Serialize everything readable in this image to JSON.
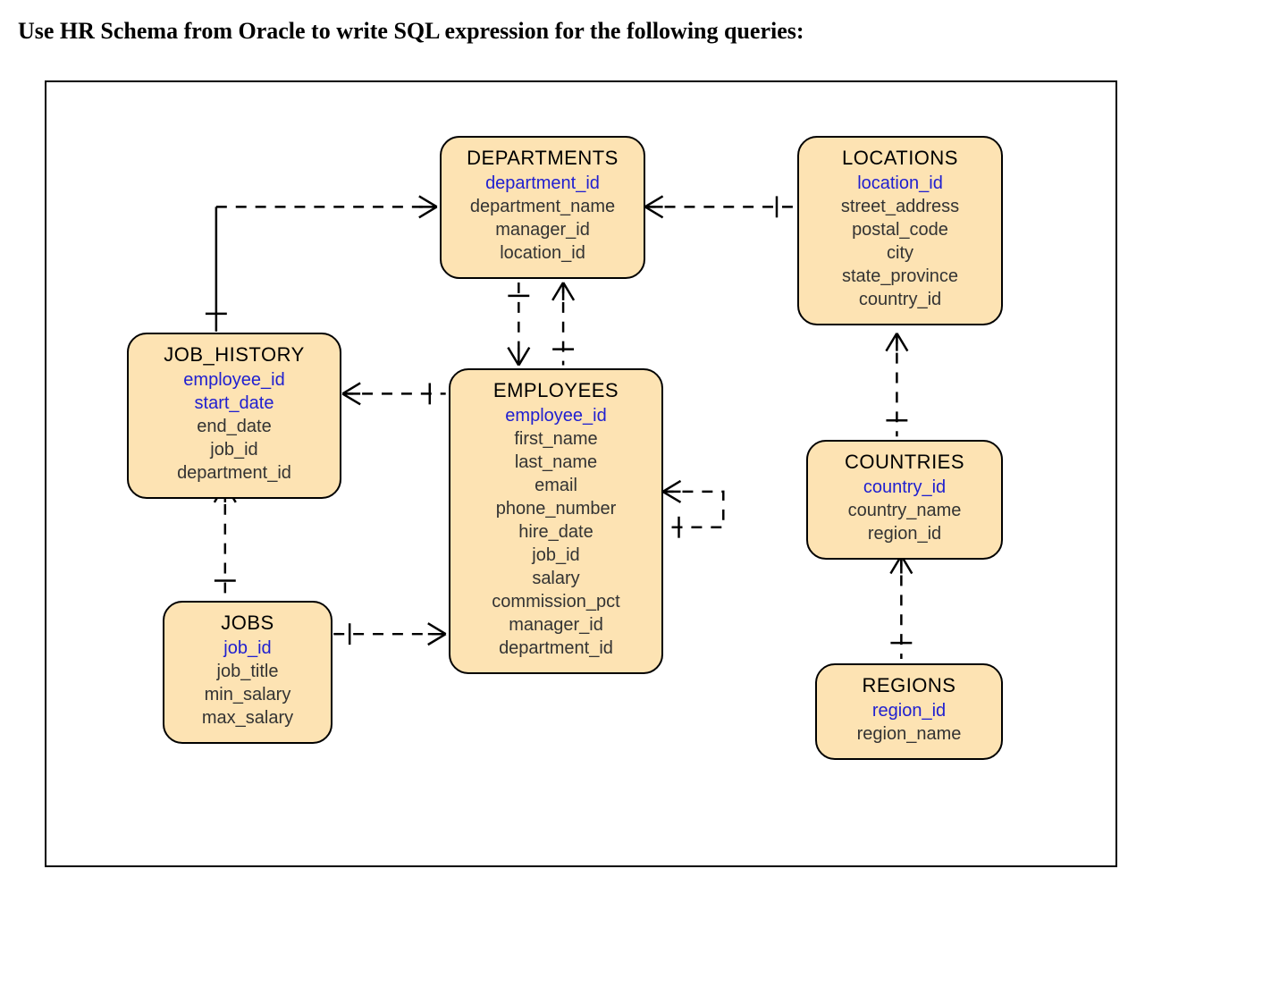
{
  "heading": "Use HR Schema from Oracle to write SQL expression for the following queries:",
  "entities": {
    "departments": {
      "title": "DEPARTMENTS",
      "fields": [
        {
          "name": "department_id",
          "pk": true
        },
        {
          "name": "department_name",
          "pk": false
        },
        {
          "name": "manager_id",
          "pk": false
        },
        {
          "name": "location_id",
          "pk": false
        }
      ]
    },
    "locations": {
      "title": "LOCATIONS",
      "fields": [
        {
          "name": "location_id",
          "pk": true
        },
        {
          "name": "street_address",
          "pk": false
        },
        {
          "name": "postal_code",
          "pk": false
        },
        {
          "name": "city",
          "pk": false
        },
        {
          "name": "state_province",
          "pk": false
        },
        {
          "name": "country_id",
          "pk": false
        }
      ]
    },
    "job_history": {
      "title": "JOB_HISTORY",
      "fields": [
        {
          "name": "employee_id",
          "pk": true
        },
        {
          "name": "start_date",
          "pk": true
        },
        {
          "name": "end_date",
          "pk": false
        },
        {
          "name": "job_id",
          "pk": false
        },
        {
          "name": "department_id",
          "pk": false
        }
      ]
    },
    "employees": {
      "title": "EMPLOYEES",
      "fields": [
        {
          "name": "employee_id",
          "pk": true
        },
        {
          "name": "first_name",
          "pk": false
        },
        {
          "name": "last_name",
          "pk": false
        },
        {
          "name": "email",
          "pk": false
        },
        {
          "name": "phone_number",
          "pk": false
        },
        {
          "name": "hire_date",
          "pk": false
        },
        {
          "name": "job_id",
          "pk": false
        },
        {
          "name": "salary",
          "pk": false
        },
        {
          "name": "commission_pct",
          "pk": false
        },
        {
          "name": "manager_id",
          "pk": false
        },
        {
          "name": "department_id",
          "pk": false
        }
      ]
    },
    "countries": {
      "title": "COUNTRIES",
      "fields": [
        {
          "name": "country_id",
          "pk": true
        },
        {
          "name": "country_name",
          "pk": false
        },
        {
          "name": "region_id",
          "pk": false
        }
      ]
    },
    "jobs": {
      "title": "JOBS",
      "fields": [
        {
          "name": "job_id",
          "pk": true
        },
        {
          "name": "job_title",
          "pk": false
        },
        {
          "name": "min_salary",
          "pk": false
        },
        {
          "name": "max_salary",
          "pk": false
        }
      ]
    },
    "regions": {
      "title": "REGIONS",
      "fields": [
        {
          "name": "region_id",
          "pk": true
        },
        {
          "name": "region_name",
          "pk": false
        }
      ]
    }
  },
  "relationships": [
    {
      "from": "job_history",
      "to": "departments",
      "type": "many-to-one"
    },
    {
      "from": "job_history",
      "to": "employees",
      "type": "many-to-one"
    },
    {
      "from": "job_history",
      "to": "jobs",
      "type": "many-to-one"
    },
    {
      "from": "employees",
      "to": "departments",
      "type": "many-to-one"
    },
    {
      "from": "employees",
      "to": "employees",
      "type": "self-manager"
    },
    {
      "from": "employees",
      "to": "jobs",
      "type": "many-to-one"
    },
    {
      "from": "departments",
      "to": "locations",
      "type": "many-to-one"
    },
    {
      "from": "locations",
      "to": "countries",
      "type": "many-to-one"
    },
    {
      "from": "countries",
      "to": "regions",
      "type": "many-to-one"
    }
  ]
}
